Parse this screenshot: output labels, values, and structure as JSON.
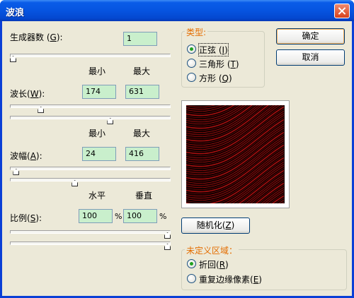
{
  "window": {
    "title": "波浪"
  },
  "generators": {
    "label": "生成器数",
    "hotkey": "G",
    "value": "1",
    "level": 0
  },
  "range_headers": {
    "min": "最小",
    "max": "最大"
  },
  "wavelength": {
    "label": "波长",
    "hotkey": "W",
    "min_value": "174",
    "max_value": "631",
    "min_level": 0.18,
    "max_level": 0.63
  },
  "amplitude": {
    "label": "波幅",
    "hotkey": "A",
    "min_value": "24",
    "max_value": "416",
    "min_level": 0.02,
    "max_level": 0.4
  },
  "scale": {
    "label": "比例",
    "hotkey": "S",
    "col_horizontal": "水平",
    "col_vertical": "垂直",
    "horizontal_value": "100",
    "vertical_value": "100",
    "unit": "%",
    "h_level": 1.0,
    "v_level": 1.0
  },
  "type_group": {
    "legend": "类型:",
    "options": [
      {
        "label": "正弦",
        "hotkey": "I",
        "selected": true
      },
      {
        "label": "三角形",
        "hotkey": "T",
        "selected": false
      },
      {
        "label": "方形",
        "hotkey": "Q",
        "selected": false
      }
    ]
  },
  "buttons": {
    "ok": "确定",
    "cancel": "取消",
    "randomize": "随机化",
    "randomize_hotkey": "Z"
  },
  "undefined_areas": {
    "legend": "未定义区域：",
    "options": [
      {
        "label": "折回",
        "hotkey": "R",
        "selected": true
      },
      {
        "label": "重复边缘像素",
        "hotkey": "E",
        "selected": false
      }
    ]
  },
  "colors": {
    "field_bg": "#c9efcc",
    "legend": "#e46d00",
    "dialog_bg": "#ece9d8",
    "titlebar": "#0654e0",
    "wave": "#b01010"
  },
  "icons": {
    "close": "close-icon",
    "radio": "radio-icon",
    "slider": "slider-thumb-icon"
  }
}
